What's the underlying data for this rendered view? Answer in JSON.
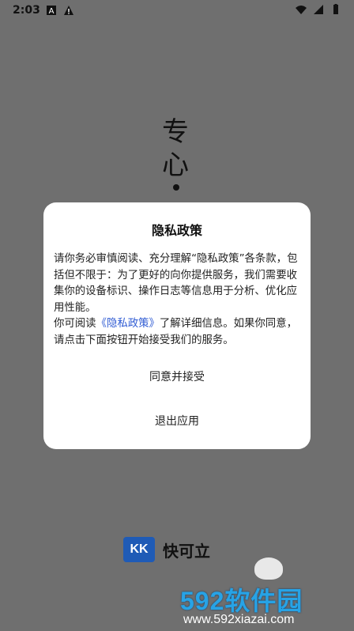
{
  "status_bar": {
    "time": "2:03",
    "left_icons": [
      "a-notification-icon",
      "warning-icon"
    ],
    "right_icons": [
      "wifi-icon",
      "signal-icon",
      "battery-icon"
    ]
  },
  "splash": {
    "text": "专心"
  },
  "dialog": {
    "title": "隐私政策",
    "paragraph1": "请你务必审慎阅读、充分理解“隐私政策”各条款，包括但不限于：为了更好的向你提供服务，我们需要收集你的设备标识、操作日志等信息用于分析、优化应用性能。",
    "paragraph2_prefix": "你可阅读",
    "paragraph2_link": "《隐私政策》",
    "paragraph2_suffix": "了解详细信息。如果你同意，请点击下面按钮开始接受我们的服务。",
    "agree_label": "同意并接受",
    "exit_label": "退出应用"
  },
  "brand": {
    "logo_text": "KK",
    "name": "快可立"
  },
  "watermark": {
    "main": "592软件园",
    "url": "www.592xiazai.com"
  }
}
